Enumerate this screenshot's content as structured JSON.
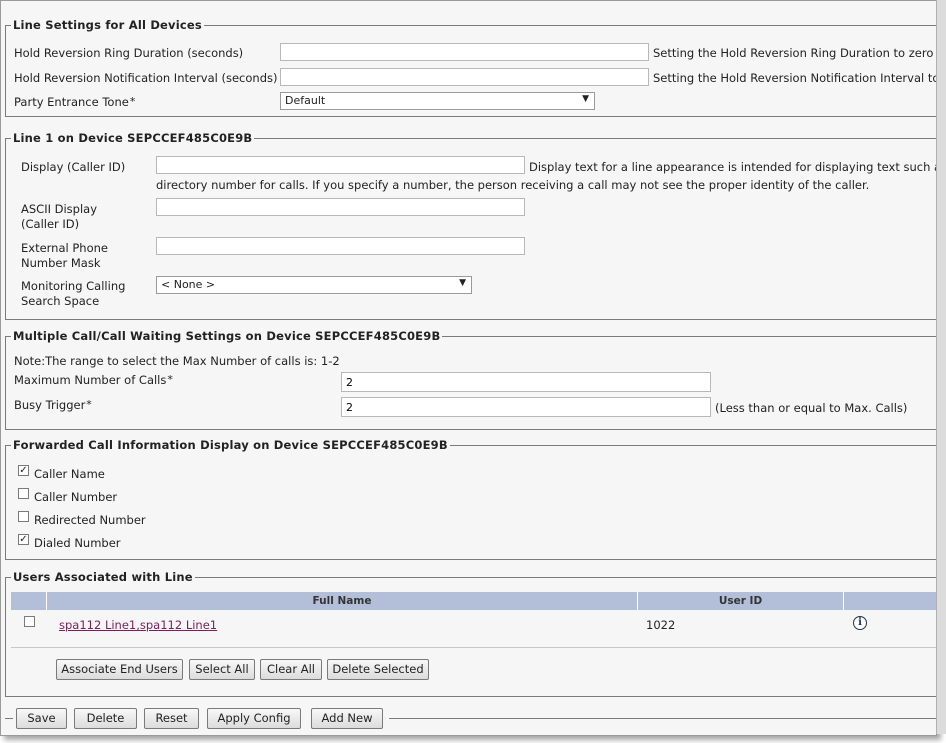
{
  "line_settings": {
    "legend": "Line Settings for All Devices",
    "hold_ring_duration": {
      "label": "Hold Reversion Ring Duration (seconds)",
      "value": "",
      "help": "Setting the Hold Reversion Ring Duration to zero"
    },
    "hold_notify_interval": {
      "label": "Hold Reversion Notification Interval (seconds)",
      "value": "",
      "help": "Setting the Hold Reversion Notification Interval to"
    },
    "party_entrance_tone": {
      "label": "Party Entrance Tone",
      "required": "*",
      "selected": "Default"
    }
  },
  "line1": {
    "legend": "Line 1 on Device SEPCCEF485C0E9B",
    "display": {
      "label": "Display (Caller ID)",
      "value": "",
      "help_line1": "Display text for a line appearance is intended for displaying text such a",
      "help_line2": "directory number for calls. If you specify a number, the person receiving a call may not see the proper identity of the caller."
    },
    "ascii_display": {
      "label_line1": "ASCII Display",
      "label_line2": "(Caller ID)",
      "value": ""
    },
    "external_mask": {
      "label_line1": "External Phone",
      "label_line2": "Number Mask",
      "value": ""
    },
    "monitoring_css": {
      "label_line1": "Monitoring Calling",
      "label_line2": "Search Space",
      "selected": "< None >"
    }
  },
  "multiple_call": {
    "legend": "Multiple Call/Call Waiting Settings on Device SEPCCEF485C0E9B",
    "note": "Note:The range to select the Max Number of calls is: 1-2",
    "max_calls": {
      "label": "Maximum Number of Calls",
      "required": "*",
      "value": "2"
    },
    "busy_trigger": {
      "label": "Busy Trigger",
      "required": "*",
      "value": "2",
      "help": "(Less than or equal to Max. Calls)"
    }
  },
  "forwarded": {
    "legend": "Forwarded Call Information Display on Device SEPCCEF485C0E9B",
    "items": [
      {
        "label": "Caller Name",
        "checked": true,
        "mark": "✓"
      },
      {
        "label": "Caller Number",
        "checked": false,
        "mark": ""
      },
      {
        "label": "Redirected Number",
        "checked": false,
        "mark": ""
      },
      {
        "label": "Dialed Number",
        "checked": true,
        "mark": "✓"
      }
    ]
  },
  "users": {
    "legend": "Users Associated with Line",
    "columns": [
      "Full Name",
      "User ID"
    ],
    "rows": [
      {
        "full_name": "spa112 Line1,spa112 Line1",
        "user_id": "1022"
      }
    ],
    "header_color": "#b3bfd9",
    "buttons": {
      "associate": "Associate End Users",
      "select_all": "Select All",
      "clear_all": "Clear All",
      "delete_selected": "Delete Selected"
    }
  },
  "toolbar": {
    "save": "Save",
    "delete": "Delete",
    "reset": "Reset",
    "apply_config": "Apply Config",
    "add_new": "Add New"
  },
  "icons": {
    "info": "info-icon",
    "dropdown": "chevron-down-icon",
    "checkbox": "checkbox-icon"
  }
}
